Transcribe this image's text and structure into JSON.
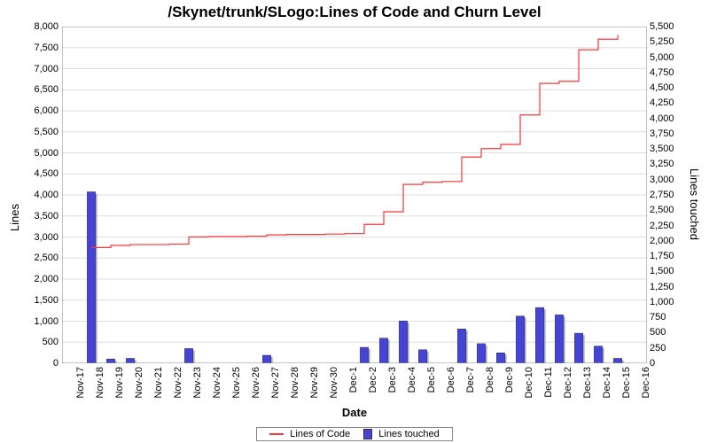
{
  "chart_data": {
    "type": "combo",
    "title": "/Skynet/trunk/SLogo:Lines of Code and Churn Level",
    "xlabel": "Date",
    "y1label": "Lines",
    "y2label": "Lines touched",
    "y1": {
      "min": 0,
      "max": 8000,
      "step": 500
    },
    "y2": {
      "min": 0,
      "max": 5500,
      "step": 250
    },
    "categories": [
      "17-Nov",
      "18-Nov",
      "19-Nov",
      "20-Nov",
      "21-Nov",
      "22-Nov",
      "23-Nov",
      "24-Nov",
      "25-Nov",
      "26-Nov",
      "27-Nov",
      "28-Nov",
      "29-Nov",
      "30-Nov",
      "1-Dec",
      "2-Dec",
      "3-Dec",
      "4-Dec",
      "5-Dec",
      "6-Dec",
      "7-Dec",
      "8-Dec",
      "9-Dec",
      "10-Dec",
      "11-Dec",
      "12-Dec",
      "13-Dec",
      "14-Dec",
      "15-Dec",
      "16-Dec"
    ],
    "series": [
      {
        "name": "Lines of Code",
        "kind": "line",
        "axis": "y1",
        "color": "#f33",
        "values": [
          null,
          2750,
          2800,
          2820,
          2820,
          2830,
          3000,
          3010,
          3010,
          3020,
          3050,
          3060,
          3060,
          3070,
          3080,
          3300,
          3600,
          4250,
          4300,
          4320,
          4900,
          5100,
          5200,
          5900,
          6650,
          6700,
          7450,
          7700,
          7800,
          null
        ]
      },
      {
        "name": "Lines touched",
        "kind": "bar",
        "axis": "y2",
        "color": "#44d",
        "values": [
          0,
          2800,
          70,
          80,
          0,
          0,
          240,
          0,
          0,
          0,
          130,
          0,
          0,
          0,
          0,
          260,
          410,
          690,
          220,
          0,
          560,
          320,
          170,
          770,
          910,
          790,
          490,
          280,
          80,
          0
        ]
      }
    ],
    "legend": [
      "Lines of Code",
      "Lines touched"
    ]
  }
}
